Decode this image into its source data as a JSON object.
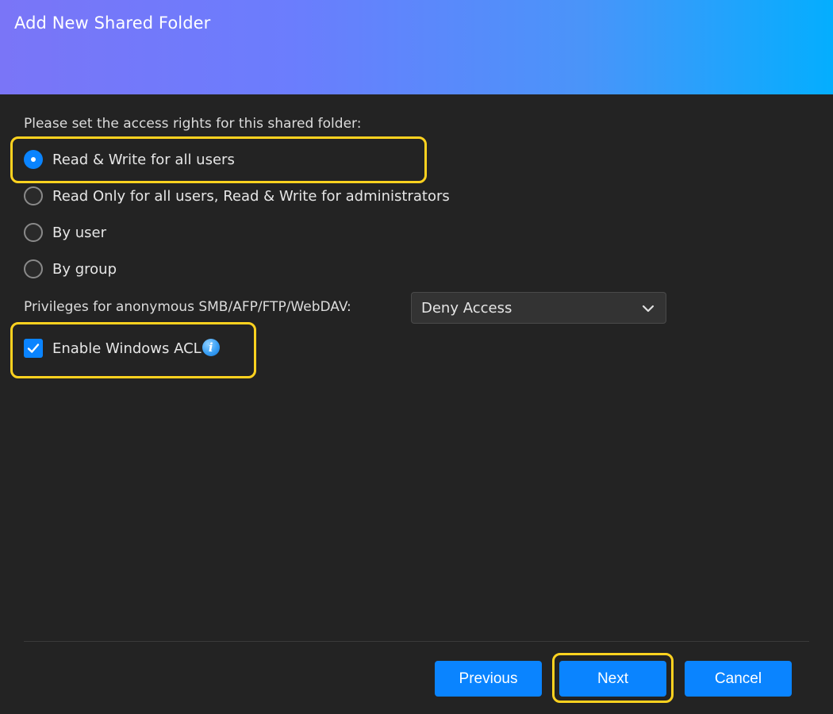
{
  "dialog": {
    "title": "Add New Shared Folder"
  },
  "access": {
    "prompt": "Please set the access rights for this shared folder:",
    "options": [
      {
        "label": "Read & Write for all users",
        "checked": true
      },
      {
        "label": "Read Only for all users, Read & Write for administrators",
        "checked": false
      },
      {
        "label": "By user",
        "checked": false
      },
      {
        "label": "By group",
        "checked": false
      }
    ]
  },
  "anonymous": {
    "label": "Privileges for anonymous SMB/AFP/FTP/WebDAV:",
    "selected": "Deny Access"
  },
  "acl": {
    "label": "Enable Windows ACL",
    "checked": true,
    "info_icon": "info-icon"
  },
  "buttons": {
    "previous": "Previous",
    "next": "Next",
    "cancel": "Cancel"
  },
  "colors": {
    "accent": "#0a84ff",
    "highlight": "#ffd21f",
    "background": "#232323",
    "header_gradient_start": "#7a75f7",
    "header_gradient_end": "#04aefe"
  }
}
